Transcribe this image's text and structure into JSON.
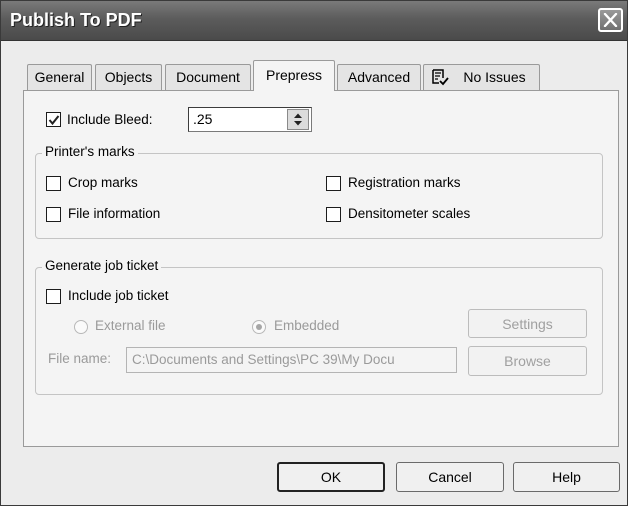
{
  "window": {
    "title": "Publish To PDF"
  },
  "tabs": [
    {
      "label": "General",
      "active": false
    },
    {
      "label": "Objects",
      "active": false
    },
    {
      "label": "Document",
      "active": false
    },
    {
      "label": "Prepress",
      "active": true
    },
    {
      "label": "Advanced",
      "active": false
    },
    {
      "label": "No Issues",
      "active": false,
      "icon": "issues-icon"
    }
  ],
  "bleed": {
    "label": "Include Bleed:",
    "checked": true,
    "value": ".25"
  },
  "printers_marks": {
    "legend": "Printer's marks",
    "items": [
      {
        "label": "Crop marks",
        "checked": false
      },
      {
        "label": "Registration marks",
        "checked": false
      },
      {
        "label": "File information",
        "checked": false
      },
      {
        "label": "Densitometer scales",
        "checked": false
      }
    ]
  },
  "job_ticket": {
    "legend": "Generate job ticket",
    "include_label": "Include job ticket",
    "include_checked": false,
    "radio_external": "External file",
    "radio_embedded": "Embedded",
    "selected": "Embedded",
    "file_name_label": "File name:",
    "file_name_value": "C:\\Documents and Settings\\PC 39\\My Docu",
    "settings_label": "Settings",
    "browse_label": "Browse"
  },
  "footer": {
    "ok_label": "OK",
    "cancel_label": "Cancel",
    "help_label": "Help"
  }
}
